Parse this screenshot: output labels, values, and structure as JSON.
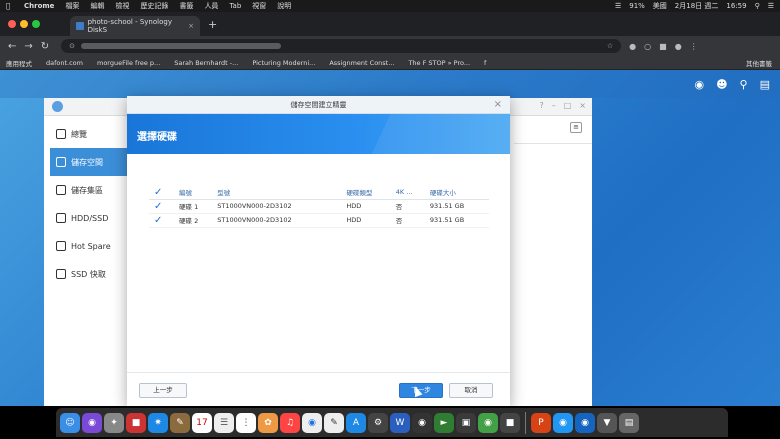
{
  "menubar": {
    "items": [
      "Chrome",
      "檔案",
      "編輯",
      "檢視",
      "歷史記錄",
      "書籤",
      "人員",
      "Tab",
      "視窗",
      "說明"
    ],
    "battery": "91%",
    "input_source": "美國",
    "date": "2月18日 週二",
    "time": "16:59"
  },
  "browser": {
    "tab_title": "photo-school - Synology DiskS",
    "bookmarks": [
      "應用程式",
      "dafont.com",
      "morgueFile free p...",
      "Sarah Bernhardt -...",
      "Picturing Moderni...",
      "Assignment Const...",
      "The F STOP » Pro...",
      "其他書籤"
    ]
  },
  "app": {
    "sidebar": [
      {
        "label": "總覽"
      },
      {
        "label": "儲存空間"
      },
      {
        "label": "儲存集區"
      },
      {
        "label": "HDD/SSD"
      },
      {
        "label": "Hot Spare"
      },
      {
        "label": "SSD 快取"
      }
    ]
  },
  "modal": {
    "title": "儲存空間建立精靈",
    "heading": "選擇硬碟",
    "columns": [
      "編號",
      "型號",
      "硬碟類型",
      "4K ...",
      "硬碟大小"
    ],
    "rows": [
      {
        "id": "硬碟 1",
        "model": "ST1000VN000-2D3102",
        "type": "HDD",
        "4k": "否",
        "size": "931.51 GB"
      },
      {
        "id": "硬碟 2",
        "model": "ST1000VN000-2D3102",
        "type": "HDD",
        "4k": "否",
        "size": "931.51 GB"
      }
    ],
    "back_label": "上一步",
    "next_label": "下一步",
    "cancel_label": "取消"
  },
  "colors": {
    "accent": "#2f86e0",
    "banner": "#1976d8"
  }
}
